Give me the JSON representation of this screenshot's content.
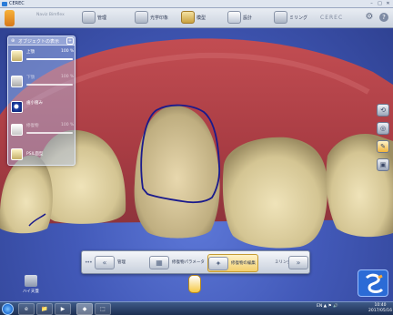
{
  "window": {
    "title": "CEREC",
    "controls": [
      "–",
      "□",
      "✕"
    ]
  },
  "phasebar": {
    "patient": "Naviz Bimflex",
    "steps": [
      {
        "label": "管理",
        "icon": "admin-icon"
      },
      {
        "label": "光学印象",
        "icon": "acquisition-icon"
      },
      {
        "label": "模型",
        "icon": "model-icon"
      },
      {
        "label": "設計",
        "icon": "design-icon",
        "active": true
      },
      {
        "label": "ミリング",
        "icon": "milling-icon"
      }
    ],
    "brand": "CEREC"
  },
  "object_panel": {
    "title": "オブジェクトの表示",
    "items": [
      {
        "label": "上顎",
        "value": "100 %",
        "level": 1.0
      },
      {
        "label": "下顎",
        "value": "100 %",
        "level": 1.0,
        "disabled": true
      },
      {
        "label": "歯小窩み"
      },
      {
        "label": "修復物",
        "value": "100 %",
        "level": 1.0,
        "disabled": true
      },
      {
        "label": "PSIL面型"
      }
    ]
  },
  "right_tools": [
    "⟲",
    "◎",
    "✎",
    "▣"
  ],
  "stepbar": {
    "dots": "•••",
    "items": [
      {
        "label": "管理",
        "icon": "back-chevrons-icon"
      },
      {
        "label": "修復物パラメータ",
        "icon": "restoration-parameters-icon"
      },
      {
        "label": "修復物の編集",
        "icon": "edit-restoration-icon",
        "active": true
      },
      {
        "label": "ミリング",
        "icon": "forward-chevrons-icon"
      }
    ]
  },
  "bottom_left": {
    "label": "ハイ天蓋"
  },
  "taskbar": {
    "apps": [
      "e",
      "📁",
      "▶",
      "◆",
      "⬚"
    ],
    "tray": "EN  ▲  ⚑  🔊",
    "time": "10:40",
    "date": "2017/05/16"
  },
  "colors": {
    "gingiva": "#b84b4f",
    "tooth": "#ddcfa4",
    "background": "#4259b8",
    "margin_line": "#1a1a8c"
  }
}
